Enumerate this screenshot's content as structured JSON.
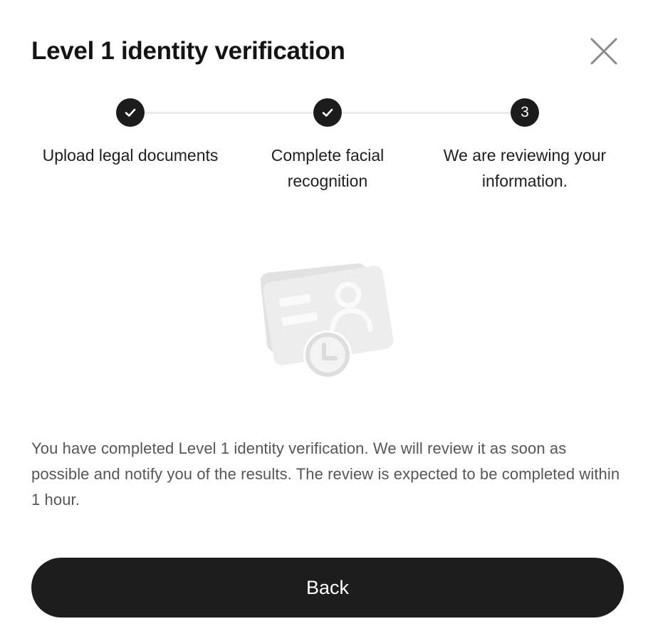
{
  "dialog": {
    "title": "Level 1 identity verification",
    "close_icon": "close-icon"
  },
  "stepper": {
    "steps": [
      {
        "marker": "check-icon",
        "label": "Upload legal documents",
        "status": "completed"
      },
      {
        "marker": "check-icon",
        "label": "Complete facial recognition",
        "status": "completed"
      },
      {
        "marker": "3",
        "label": "We are reviewing your information.",
        "status": "current"
      }
    ]
  },
  "illustration": {
    "icon": "id-card-pending-review-icon"
  },
  "message": "You have completed Level 1 identity verification. We will review it as soon as possible and notify you of the results. The review is expected to be completed within 1 hour.",
  "actions": {
    "back_label": "Back"
  },
  "colors": {
    "primary": "#1d1d1d",
    "text_secondary": "#565656",
    "step_line": "#ebebeb",
    "illustration_gray": "#e4e4e4"
  }
}
